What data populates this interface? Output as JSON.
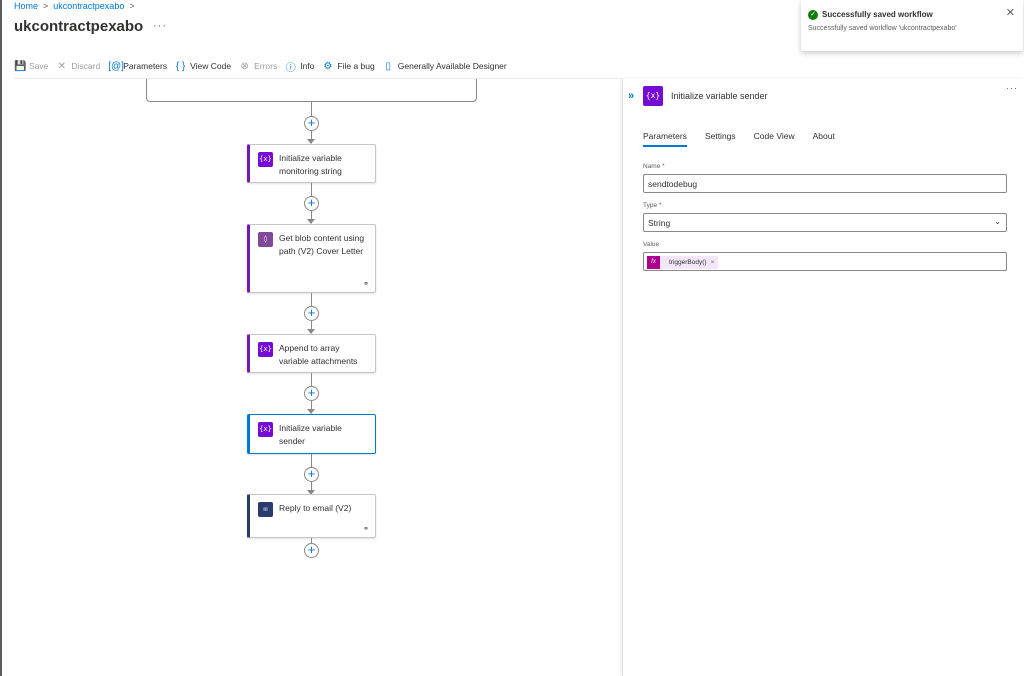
{
  "breadcrumb": {
    "home": "Home",
    "resource": "ukcontractpexabo",
    "sep": ">"
  },
  "page": {
    "title": "ukcontractpexabo",
    "more": "···"
  },
  "toolbar": {
    "save": "Save",
    "discard": "Discard",
    "parameters": "Parameters",
    "view_code": "View Code",
    "errors": "Errors",
    "info": "Info",
    "file_bug": "File a bug",
    "ga_designer": "Generally Available Designer"
  },
  "workflow": {
    "steps": [
      {
        "title": "Initialize variable monitoring string",
        "icon": "variable-icon"
      },
      {
        "title": "Get blob content using path (V2) Cover Letter",
        "icon": "blob-storage-icon"
      },
      {
        "title": "Append to array variable attachments",
        "icon": "variable-icon"
      },
      {
        "title": "Initialize variable sender",
        "icon": "variable-icon"
      },
      {
        "title": "Reply to email (V2)",
        "icon": "outlook-mail-icon"
      }
    ]
  },
  "panel": {
    "title": "Initialize variable sender",
    "more": "···",
    "tabs": [
      "Parameters",
      "Settings",
      "Code View",
      "About"
    ],
    "name_label": "Name *",
    "name_value": "sendtodebug",
    "type_label": "Type *",
    "type_value": "String",
    "value_label": "Value",
    "value_token": "triggerBody()",
    "token_fx": "fx",
    "token_remove": "×"
  },
  "toast": {
    "title": "Successfully saved workflow",
    "message": "Successfully saved workflow 'ukcontractpexabo'",
    "close": "✕"
  },
  "colors": {
    "accent": "#0078d4",
    "variable": "#770bd6",
    "success": "#107c10"
  }
}
